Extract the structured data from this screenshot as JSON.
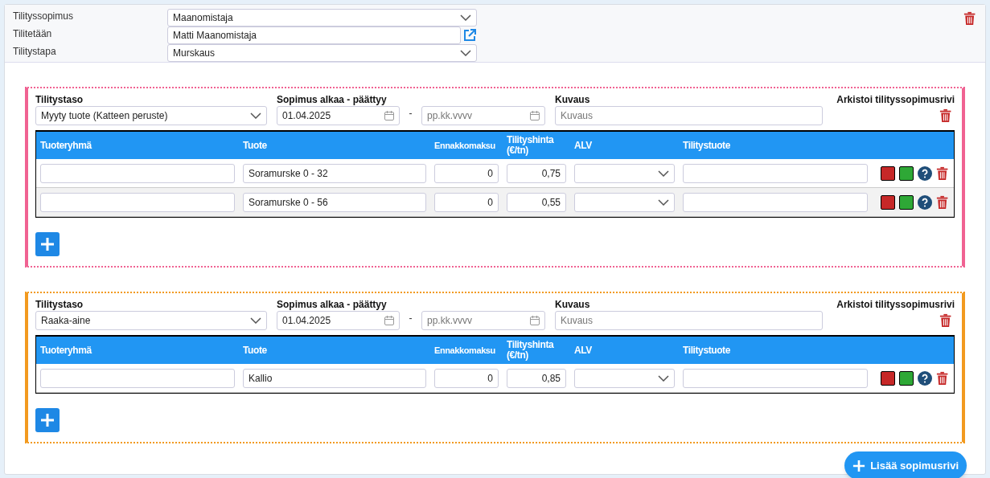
{
  "header": {
    "fields": [
      {
        "label": "Tilityssopimus",
        "kind": "select",
        "value": "Maanomistaja"
      },
      {
        "label": "Tilitetään",
        "kind": "link",
        "value": "Matti Maanomistaja"
      },
      {
        "label": "Tilitystapa",
        "kind": "select",
        "value": "Murskaus"
      }
    ]
  },
  "sections": [
    {
      "color": "#f06292",
      "level_label": "Tilitystaso",
      "level_value": "Myyty tuote (Katteen peruste)",
      "dates_label": "Sopimus alkaa - päättyy",
      "start": "01.04.2025",
      "separator": "-",
      "end_placeholder": "pp.kk.vvvv",
      "description_label": "Kuvaus",
      "description_placeholder": "Kuvaus",
      "archive_label": "Arkistoi tilityssopimusrivi",
      "columns": [
        "Tuoteryhmä",
        "Tuote",
        "Ennakkomaksu",
        "Tilityshinta (€/tn)",
        "ALV",
        "Tilitystuote"
      ],
      "rows": [
        {
          "product": "Soramurske 0 - 32",
          "advance": "0",
          "price": "0,75"
        },
        {
          "product": "Soramurske 0 - 56",
          "advance": "0",
          "price": "0,55"
        }
      ]
    },
    {
      "color": "#f29a1f",
      "level_label": "Tilitystaso",
      "level_value": "Raaka-aine",
      "dates_label": "Sopimus alkaa - päättyy",
      "start": "01.04.2025",
      "separator": "-",
      "end_placeholder": "pp.kk.vvvv",
      "description_label": "Kuvaus",
      "description_placeholder": "Kuvaus",
      "archive_label": "Arkistoi tilityssopimusrivi",
      "columns": [
        "Tuoteryhmä",
        "Tuote",
        "Ennakkomaksu",
        "Tilityshinta (€/tn)",
        "ALV",
        "Tilitystuote"
      ],
      "rows": [
        {
          "product": "Kallio",
          "advance": "0",
          "price": "0,85"
        }
      ]
    }
  ],
  "add_row_button": "Lisää sopimusrivi"
}
